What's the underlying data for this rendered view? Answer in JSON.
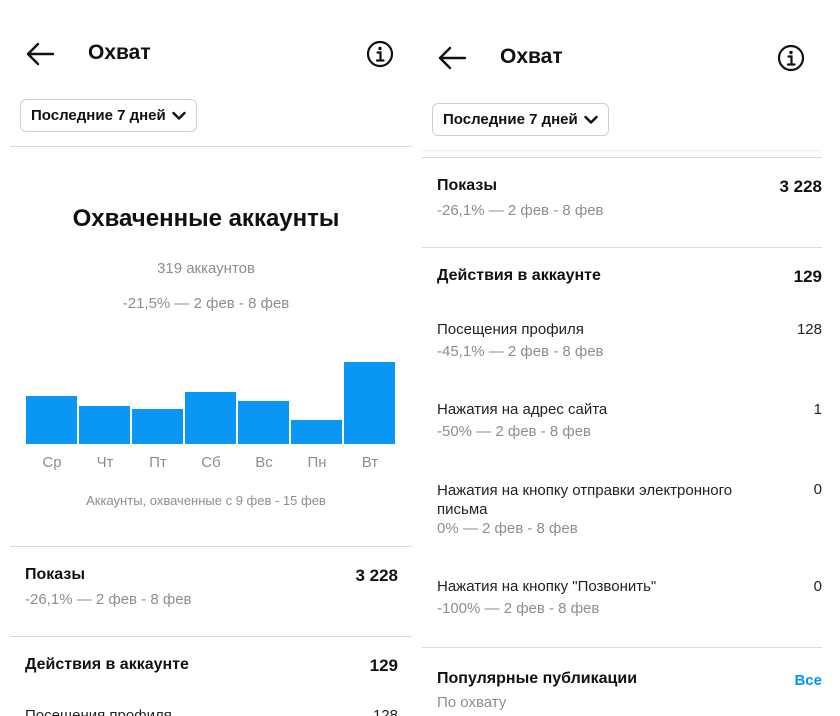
{
  "header": {
    "title": "Охват",
    "period_label": "Последние 7 дней"
  },
  "reach": {
    "title": "Охваченные аккаунты",
    "count": "319 аккаунтов",
    "change": "-21,5% — 2 фев - 8 фев",
    "caption": "Аккаунты, охваченные с 9 фев - 15 фев"
  },
  "chart_data": {
    "type": "bar",
    "categories": [
      "Ср",
      "Чт",
      "Пт",
      "Сб",
      "Вс",
      "Пн",
      "Вт"
    ],
    "values": [
      47,
      38,
      35,
      51,
      43,
      24,
      81
    ],
    "ylim": [
      0,
      90
    ],
    "bar_color": "#0a96f5"
  },
  "impressions": {
    "label": "Показы",
    "value": "3 228",
    "change": "-26,1% — 2 фев - 8 фев"
  },
  "actions": {
    "label": "Действия в аккаунте",
    "value": "129",
    "items": [
      {
        "label": "Посещения профиля",
        "value": "128",
        "change": "-45,1% — 2 фев - 8 фев"
      },
      {
        "label": "Нажатия на адрес сайта",
        "value": "1",
        "change": "-50% — 2 фев - 8 фев"
      },
      {
        "label": "Нажатия на кнопку отправки электронного письма",
        "value": "0",
        "change": "0% — 2 фев - 8 фев"
      },
      {
        "label": "Нажатия на кнопку \"Позвонить\"",
        "value": "0",
        "change": "-100% — 2 фев - 8 фев"
      }
    ]
  },
  "top_posts": {
    "label": "Популярные публикации",
    "subtitle": "По охвату",
    "all_label": "Все"
  },
  "icons": {
    "back": "arrow-left-icon",
    "info": "info-icon",
    "dropdown": "chevron-down-icon"
  },
  "colors": {
    "accent": "#0095f6",
    "bar": "#0a96f5",
    "muted_text": "#8e8e8e",
    "divider": "#dbdbdb"
  }
}
